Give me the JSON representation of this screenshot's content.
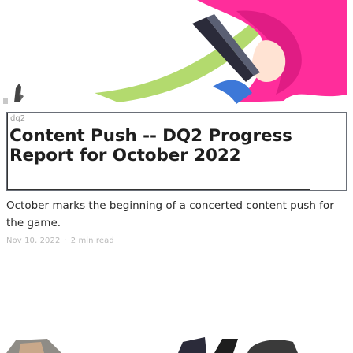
{
  "hero": {
    "icon": "game-artwork-image"
  },
  "post": {
    "image_alt": "dq2",
    "title": "Content Push -- DQ2 Progress Report for October 2022",
    "excerpt": "October marks the beginning of a concerted content push for the game.",
    "date": "Nov 10, 2022",
    "separator": "·",
    "read_time": "2 min read"
  },
  "colors": {
    "accent_pink": "#ff2d9b",
    "accent_green": "#8cc63f",
    "text_dark": "#1f1f1f",
    "meta_grey": "#b9b9b9"
  }
}
